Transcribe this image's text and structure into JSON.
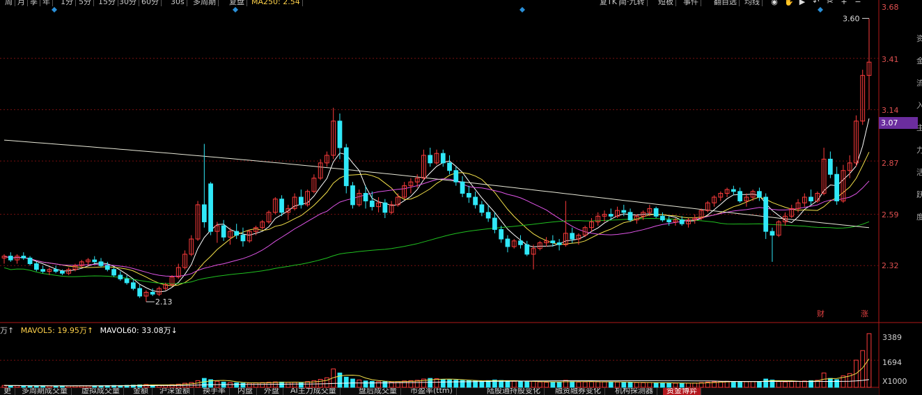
{
  "toolbar": {
    "periods": [
      "周",
      "月",
      "季",
      "年",
      "1分",
      "5分",
      "15分",
      "30分",
      "60分",
      "30s",
      "多周期",
      "复盘",
      "MA250: 2.54"
    ],
    "active_index": 12,
    "right_items": [
      "复TK",
      "简·九转",
      "短板",
      "事件",
      "翻自选",
      "均线"
    ],
    "icons": [
      "eye-icon",
      "hand-icon",
      "play-icon",
      "undo-icon",
      "scissors-icon",
      "plus-icon",
      "minus-icon"
    ]
  },
  "price_axis": {
    "labels": [
      "3.68",
      "3.41",
      "3.14",
      "2.87",
      "2.59",
      "2.32"
    ],
    "current": "3.07",
    "high_label": "3.60",
    "low_label": "2.13"
  },
  "markers": {
    "finance": "财",
    "rise": "涨"
  },
  "volume": {
    "legend_prefix": "万↑",
    "mavol5": "MAVOL5: 19.95万↑",
    "mavol60": "MAVOL60: 33.08万↓",
    "labels": [
      "3389",
      "1694"
    ],
    "unit": "X1000"
  },
  "side_text": "资金流入主力活跃度",
  "bottom_tabs": [
    "更",
    "多周期成交量",
    "虚拟成交量",
    "金额",
    "沪深金额",
    "换手率",
    "内盘",
    "外盘",
    "AI主力成交量",
    "盘后成交量",
    "市盈率(ttm)",
    "陆股通持股变化",
    "融资融券变化",
    "机构探测器",
    "资金博弈"
  ],
  "bottom_active_index": 14,
  "colors": {
    "up": "#ff3c3c",
    "down": "#30e8f8",
    "ma5": "#ffffff",
    "ma10": "#f5e24a",
    "ma20": "#e055e8",
    "ma60": "#20c020",
    "ma250": "#e8e8d8"
  },
  "chart_data": {
    "type": "candlestick",
    "price_range": [
      2.05,
      3.68
    ],
    "ohlc": [
      [
        2.36,
        2.38,
        2.33,
        2.37
      ],
      [
        2.37,
        2.39,
        2.34,
        2.35
      ],
      [
        2.35,
        2.38,
        2.33,
        2.37
      ],
      [
        2.37,
        2.39,
        2.35,
        2.36
      ],
      [
        2.36,
        2.37,
        2.32,
        2.33
      ],
      [
        2.33,
        2.34,
        2.29,
        2.3
      ],
      [
        2.3,
        2.32,
        2.28,
        2.29
      ],
      [
        2.29,
        2.31,
        2.27,
        2.3
      ],
      [
        2.3,
        2.32,
        2.28,
        2.29
      ],
      [
        2.29,
        2.3,
        2.27,
        2.28
      ],
      [
        2.28,
        2.31,
        2.27,
        2.3
      ],
      [
        2.3,
        2.33,
        2.29,
        2.32
      ],
      [
        2.32,
        2.35,
        2.31,
        2.34
      ],
      [
        2.34,
        2.36,
        2.32,
        2.35
      ],
      [
        2.35,
        2.37,
        2.33,
        2.34
      ],
      [
        2.34,
        2.36,
        2.31,
        2.32
      ],
      [
        2.32,
        2.34,
        2.29,
        2.3
      ],
      [
        2.3,
        2.31,
        2.26,
        2.27
      ],
      [
        2.27,
        2.29,
        2.24,
        2.25
      ],
      [
        2.25,
        2.27,
        2.22,
        2.23
      ],
      [
        2.23,
        2.25,
        2.19,
        2.2
      ],
      [
        2.2,
        2.22,
        2.15,
        2.16
      ],
      [
        2.16,
        2.19,
        2.13,
        2.18
      ],
      [
        2.18,
        2.2,
        2.16,
        2.17
      ],
      [
        2.17,
        2.21,
        2.16,
        2.2
      ],
      [
        2.2,
        2.23,
        2.19,
        2.22
      ],
      [
        2.22,
        2.27,
        2.21,
        2.26
      ],
      [
        2.26,
        2.33,
        2.25,
        2.31
      ],
      [
        2.31,
        2.4,
        2.3,
        2.38
      ],
      [
        2.38,
        2.48,
        2.37,
        2.46
      ],
      [
        2.46,
        2.66,
        2.45,
        2.64
      ],
      [
        2.64,
        2.96,
        2.52,
        2.55
      ],
      [
        2.75,
        2.76,
        2.48,
        2.5
      ],
      [
        2.5,
        2.55,
        2.44,
        2.53
      ],
      [
        2.53,
        2.56,
        2.45,
        2.47
      ],
      [
        2.47,
        2.52,
        2.43,
        2.5
      ],
      [
        2.5,
        2.54,
        2.46,
        2.48
      ],
      [
        2.48,
        2.52,
        2.42,
        2.45
      ],
      [
        2.45,
        2.51,
        2.44,
        2.5
      ],
      [
        2.5,
        2.53,
        2.48,
        2.52
      ],
      [
        2.52,
        2.56,
        2.51,
        2.55
      ],
      [
        2.55,
        2.61,
        2.54,
        2.6
      ],
      [
        2.6,
        2.68,
        2.59,
        2.67
      ],
      [
        2.67,
        2.69,
        2.58,
        2.6
      ],
      [
        2.6,
        2.64,
        2.56,
        2.62
      ],
      [
        2.62,
        2.7,
        2.61,
        2.68
      ],
      [
        2.68,
        2.72,
        2.62,
        2.64
      ],
      [
        2.64,
        2.72,
        2.63,
        2.71
      ],
      [
        2.71,
        2.8,
        2.7,
        2.78
      ],
      [
        2.78,
        2.88,
        2.77,
        2.86
      ],
      [
        2.86,
        2.92,
        2.84,
        2.9
      ],
      [
        2.9,
        3.15,
        2.88,
        3.08
      ],
      [
        3.08,
        3.12,
        2.88,
        2.94
      ],
      [
        2.94,
        2.96,
        2.7,
        2.74
      ],
      [
        2.74,
        2.76,
        2.62,
        2.64
      ],
      [
        2.64,
        2.72,
        2.63,
        2.7
      ],
      [
        2.7,
        2.74,
        2.62,
        2.66
      ],
      [
        2.66,
        2.71,
        2.61,
        2.63
      ],
      [
        2.63,
        2.68,
        2.6,
        2.65
      ],
      [
        2.65,
        2.67,
        2.57,
        2.6
      ],
      [
        2.6,
        2.66,
        2.59,
        2.64
      ],
      [
        2.64,
        2.7,
        2.63,
        2.68
      ],
      [
        2.68,
        2.76,
        2.67,
        2.74
      ],
      [
        2.74,
        2.78,
        2.7,
        2.76
      ],
      [
        2.76,
        2.8,
        2.73,
        2.78
      ],
      [
        2.78,
        2.93,
        2.77,
        2.9
      ],
      [
        2.9,
        2.94,
        2.84,
        2.86
      ],
      [
        2.86,
        2.93,
        2.85,
        2.91
      ],
      [
        2.91,
        2.93,
        2.84,
        2.86
      ],
      [
        2.86,
        2.9,
        2.8,
        2.82
      ],
      [
        2.82,
        2.84,
        2.74,
        2.76
      ],
      [
        2.76,
        2.79,
        2.68,
        2.7
      ],
      [
        2.7,
        2.74,
        2.65,
        2.68
      ],
      [
        2.68,
        2.71,
        2.62,
        2.64
      ],
      [
        2.64,
        2.66,
        2.58,
        2.6
      ],
      [
        2.6,
        2.64,
        2.55,
        2.57
      ],
      [
        2.57,
        2.6,
        2.49,
        2.51
      ],
      [
        2.51,
        2.53,
        2.44,
        2.46
      ],
      [
        2.46,
        2.48,
        2.39,
        2.42
      ],
      [
        2.42,
        2.46,
        2.41,
        2.45
      ],
      [
        2.45,
        2.48,
        2.41,
        2.43
      ],
      [
        2.43,
        2.45,
        2.37,
        2.38
      ],
      [
        2.38,
        2.43,
        2.3,
        2.41
      ],
      [
        2.41,
        2.45,
        2.4,
        2.44
      ],
      [
        2.44,
        2.47,
        2.42,
        2.45
      ],
      [
        2.45,
        2.48,
        2.42,
        2.44
      ],
      [
        2.44,
        2.46,
        2.4,
        2.43
      ],
      [
        2.43,
        2.66,
        2.42,
        2.49
      ],
      [
        2.49,
        2.52,
        2.44,
        2.46
      ],
      [
        2.46,
        2.49,
        2.43,
        2.48
      ],
      [
        2.48,
        2.53,
        2.47,
        2.52
      ],
      [
        2.52,
        2.57,
        2.5,
        2.55
      ],
      [
        2.55,
        2.6,
        2.53,
        2.58
      ],
      [
        2.58,
        2.61,
        2.55,
        2.59
      ],
      [
        2.59,
        2.62,
        2.56,
        2.58
      ],
      [
        2.58,
        2.63,
        2.57,
        2.61
      ],
      [
        2.61,
        2.64,
        2.58,
        2.6
      ],
      [
        2.6,
        2.62,
        2.55,
        2.56
      ],
      [
        2.56,
        2.59,
        2.54,
        2.58
      ],
      [
        2.58,
        2.61,
        2.56,
        2.6
      ],
      [
        2.6,
        2.64,
        2.58,
        2.62
      ],
      [
        2.62,
        2.63,
        2.57,
        2.58
      ],
      [
        2.58,
        2.6,
        2.55,
        2.56
      ],
      [
        2.56,
        2.58,
        2.53,
        2.55
      ],
      [
        2.55,
        2.57,
        2.53,
        2.56
      ],
      [
        2.56,
        2.58,
        2.53,
        2.54
      ],
      [
        2.54,
        2.57,
        2.52,
        2.56
      ],
      [
        2.56,
        2.59,
        2.54,
        2.57
      ],
      [
        2.57,
        2.62,
        2.56,
        2.61
      ],
      [
        2.61,
        2.66,
        2.6,
        2.65
      ],
      [
        2.65,
        2.69,
        2.63,
        2.68
      ],
      [
        2.68,
        2.71,
        2.66,
        2.7
      ],
      [
        2.7,
        2.73,
        2.68,
        2.72
      ],
      [
        2.72,
        2.74,
        2.69,
        2.71
      ],
      [
        2.71,
        2.73,
        2.65,
        2.66
      ],
      [
        2.66,
        2.7,
        2.63,
        2.68
      ],
      [
        2.68,
        2.72,
        2.66,
        2.71
      ],
      [
        2.71,
        2.73,
        2.66,
        2.68
      ],
      [
        2.68,
        2.7,
        2.46,
        2.5
      ],
      [
        2.5,
        2.52,
        2.34,
        2.48
      ],
      [
        2.48,
        2.56,
        2.47,
        2.55
      ],
      [
        2.55,
        2.6,
        2.53,
        2.58
      ],
      [
        2.58,
        2.64,
        2.57,
        2.62
      ],
      [
        2.62,
        2.67,
        2.6,
        2.65
      ],
      [
        2.65,
        2.7,
        2.63,
        2.68
      ],
      [
        2.68,
        2.72,
        2.64,
        2.66
      ],
      [
        2.66,
        2.71,
        2.65,
        2.7
      ],
      [
        2.7,
        2.94,
        2.69,
        2.88
      ],
      [
        2.88,
        2.92,
        2.78,
        2.8
      ],
      [
        2.8,
        2.84,
        2.64,
        2.66
      ],
      [
        2.66,
        2.85,
        2.65,
        2.82
      ],
      [
        2.82,
        2.9,
        2.78,
        2.86
      ],
      [
        2.86,
        3.11,
        2.84,
        3.08
      ],
      [
        3.08,
        3.35,
        3.06,
        3.32
      ],
      [
        3.32,
        3.62,
        3.14,
        3.39
      ]
    ],
    "volume": [
      120,
      110,
      105,
      100,
      95,
      98,
      90,
      92,
      88,
      85,
      90,
      95,
      100,
      98,
      96,
      94,
      110,
      120,
      115,
      125,
      140,
      160,
      180,
      150,
      130,
      150,
      170,
      200,
      260,
      300,
      420,
      560,
      480,
      380,
      330,
      300,
      280,
      260,
      270,
      290,
      300,
      320,
      340,
      330,
      310,
      320,
      300,
      360,
      420,
      500,
      600,
      1150,
      900,
      640,
      520,
      460,
      400,
      380,
      360,
      350,
      340,
      360,
      400,
      420,
      440,
      520,
      560,
      540,
      500,
      470,
      450,
      430,
      410,
      400,
      390,
      420,
      460,
      430,
      400,
      380,
      360,
      350,
      380,
      340,
      320,
      330,
      320,
      440,
      360,
      330,
      340,
      350,
      360,
      350,
      340,
      330,
      320,
      310,
      300,
      290,
      300,
      290,
      280,
      270,
      260,
      250,
      260,
      270,
      300,
      330,
      350,
      370,
      380,
      360,
      340,
      350,
      360,
      370,
      520,
      460,
      360,
      340,
      360,
      380,
      400,
      420,
      440,
      900,
      560,
      480,
      720,
      860,
      1700,
      2300,
      3360
    ]
  }
}
